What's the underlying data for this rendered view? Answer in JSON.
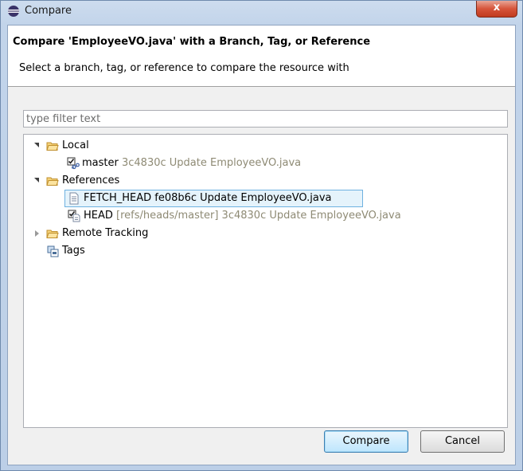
{
  "window": {
    "title": "Compare",
    "close_label": "x"
  },
  "header": {
    "title": "Compare 'EmployeeVO.java' with a Branch, Tag, or Reference",
    "description": "Select a branch, tag, or reference to compare the resource with"
  },
  "filter": {
    "placeholder": "type filter text",
    "value": ""
  },
  "tree": {
    "local": {
      "label": "Local",
      "expanded": true,
      "children": [
        {
          "name": "master",
          "detail": "3c4830c Update EmployeeVO.java",
          "icon": "branch-checked-icon"
        }
      ]
    },
    "references": {
      "label": "References",
      "expanded": true,
      "children": [
        {
          "name": "FETCH_HEAD fe08b6c Update EmployeeVO.java",
          "detail": "",
          "icon": "file-icon",
          "selected": true
        },
        {
          "name": "HEAD",
          "detail": "[refs/heads/master] 3c4830c Update EmployeeVO.java",
          "icon": "head-ref-icon"
        }
      ]
    },
    "remote_tracking": {
      "label": "Remote Tracking",
      "expanded": false
    },
    "tags": {
      "label": "Tags"
    }
  },
  "buttons": {
    "compare": "Compare",
    "cancel": "Cancel"
  },
  "colors": {
    "folder": "#e8b84a",
    "selection_border": "#6eb1e0",
    "muted_text": "#8e8a74"
  }
}
